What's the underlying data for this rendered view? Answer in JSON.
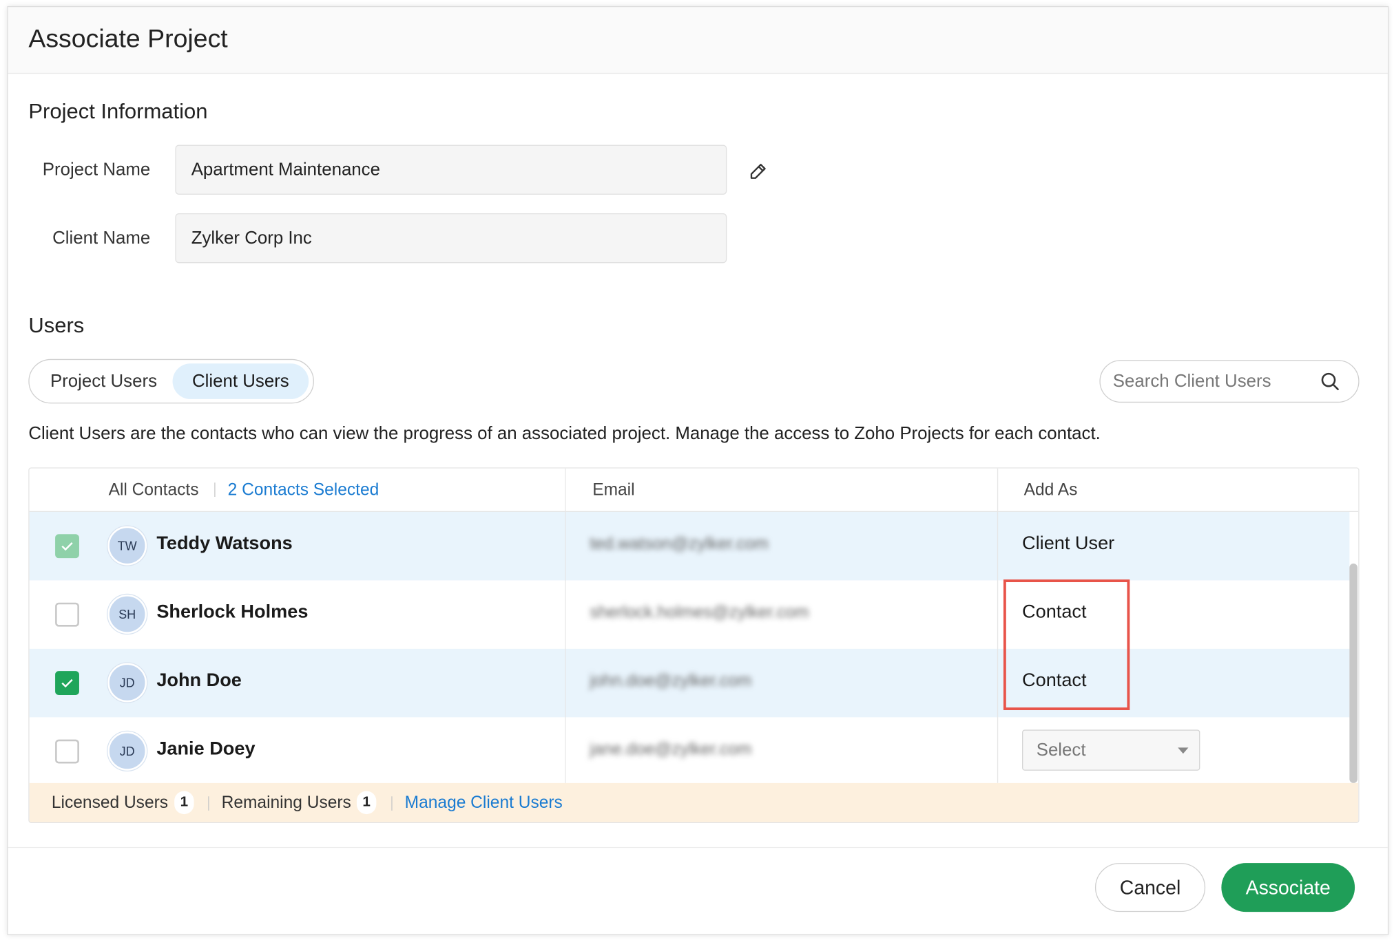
{
  "dialog": {
    "title": "Associate Project"
  },
  "project_info": {
    "section_title": "Project Information",
    "project_name_label": "Project Name",
    "project_name_value": "Apartment Maintenance",
    "client_name_label": "Client Name",
    "client_name_value": "Zylker Corp Inc"
  },
  "users": {
    "section_title": "Users",
    "tabs": [
      {
        "label": "Project Users",
        "active": false
      },
      {
        "label": "Client Users",
        "active": true
      }
    ],
    "search_placeholder": "Search Client Users",
    "description": "Client Users are the contacts who can view the progress of an associated project. Manage the access to Zoho Projects for each contact."
  },
  "table": {
    "headers": {
      "all_contacts": "All Contacts",
      "selected_count": "2 Contacts Selected",
      "email": "Email",
      "add_as": "Add As"
    },
    "rows": [
      {
        "initials": "TW",
        "name": "Teddy Watsons",
        "email": "ted.watson@zylker.com",
        "add_as": "Client User",
        "checked": true
      },
      {
        "initials": "SH",
        "name": "Sherlock Holmes",
        "email": "sherlock.holmes@zylker.com",
        "add_as": "Contact",
        "checked": false
      },
      {
        "initials": "JD",
        "name": "John Doe",
        "email": "john.doe@zylker.com",
        "add_as": "Contact",
        "checked": true
      },
      {
        "initials": "JD",
        "name": "Janie Doey",
        "email": "jane.doe@zylker.com",
        "add_as": "Select",
        "checked": false
      }
    ],
    "footer": {
      "licensed_label": "Licensed Users",
      "licensed_count": "1",
      "remaining_label": "Remaining Users",
      "remaining_count": "1",
      "manage_link": "Manage Client Users"
    }
  },
  "actions": {
    "cancel": "Cancel",
    "associate": "Associate"
  },
  "colors": {
    "accent_green": "#1f9e58",
    "link_blue": "#1a7bd1",
    "selected_row": "#e9f4fc",
    "highlight_red": "#e8544a",
    "footer_bg": "#fdf0de"
  }
}
